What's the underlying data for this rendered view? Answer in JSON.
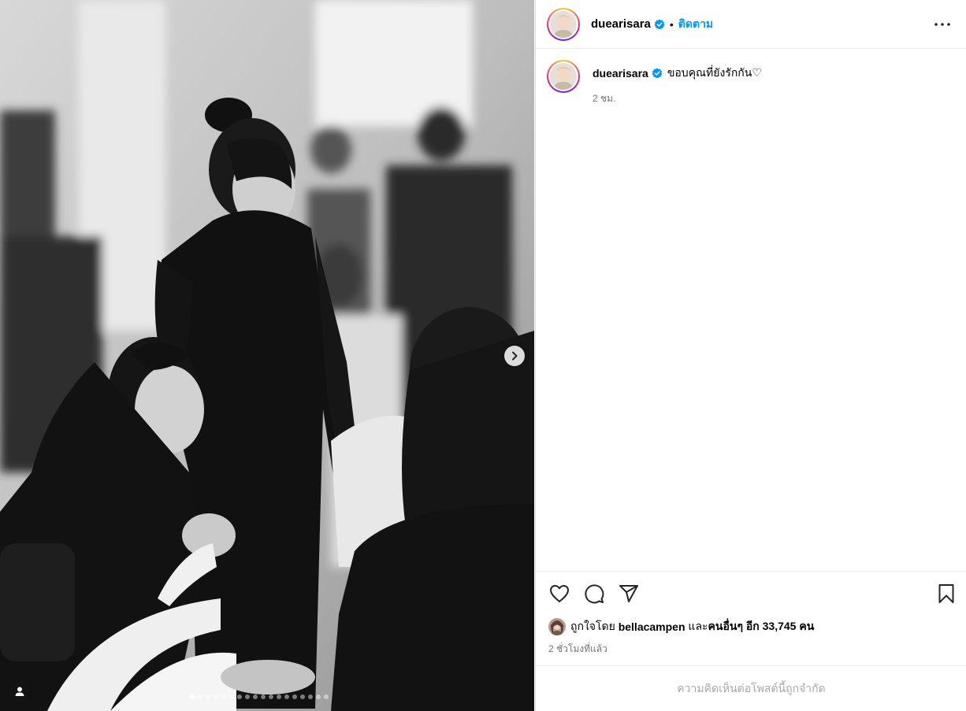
{
  "post": {
    "username": "duearisara",
    "follow_label": "ติดตาม",
    "separator": "•",
    "caption": "ขอบคุณที่ยังรักกัน♡",
    "caption_time": "2 ชม.",
    "likes": {
      "prefix": "ถูกใจโดย",
      "first_user": "bellacampen",
      "and_label": "และ",
      "others_label": "คนอื่นๆ อีก 33,745 คน"
    },
    "post_time": "2 ชั่วโมงที่แล้ว",
    "comments_limited": "ความคิดเห็นต่อโพสต์นี้ถูกจำกัด"
  },
  "carousel": {
    "total_slides": 18,
    "active_index": 0
  },
  "icons": {
    "verified": "verified-badge-icon",
    "more": "more-options-icon",
    "like": "heart-icon",
    "comment": "comment-icon",
    "share": "share-icon",
    "save": "bookmark-icon",
    "next": "chevron-right-icon",
    "tagged": "person-icon"
  },
  "colors": {
    "accent": "#0095f6",
    "verified": "#0095f6",
    "muted": "#737373",
    "disabled": "#a8a8a8"
  }
}
